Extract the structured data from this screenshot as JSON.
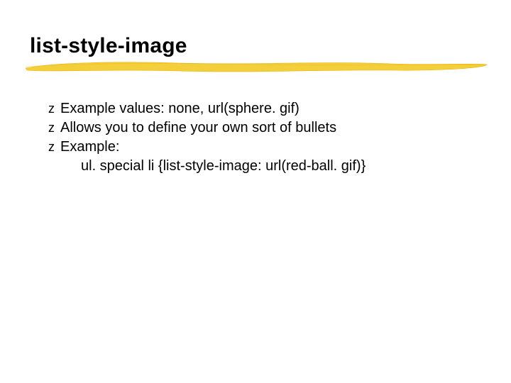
{
  "title": "list-style-image",
  "bullets": [
    {
      "text": "Example values: none, url(sphere. gif)"
    },
    {
      "text": "Allows you to define your own sort of bullets"
    },
    {
      "text": "Example:"
    }
  ],
  "sub_text": "ul. special li {list-style-image: url(red-ball. gif)}",
  "bullet_glyph": "z"
}
